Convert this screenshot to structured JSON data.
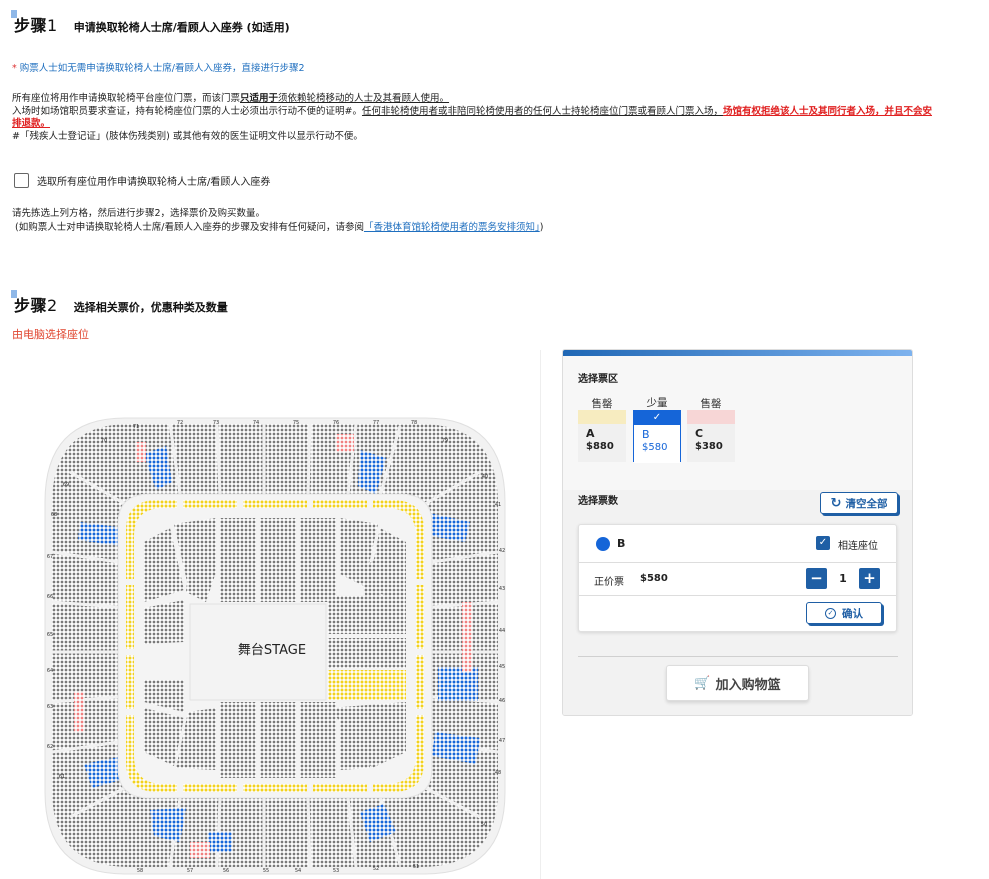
{
  "step1": {
    "label": "步骤",
    "number": "1",
    "title": "申请换取轮椅人士席/看顾人入座券 (如适用)",
    "skip_note_star": "*",
    "skip_note": " 购票人士如无需申请换取轮椅人士席/看顾人入座券，直接进行步骤2",
    "rules": {
      "line1_a": "所有座位将用作申请换取轮椅平台座位门票，而该门票",
      "line1_b": "只适用于",
      "line1_c": "须依赖轮椅移动的人士及其看顾人使用。",
      "line2_a": "入场时如场馆职员要求查证，持有轮椅座位门票的人士必须出示行动不便的证明#。",
      "line2_b": "任何非轮椅使用者或非陪同轮椅使用者的任何人士持轮椅座位门票或看顾人门票入场，",
      "line2_c": "场馆有权拒绝该人士及其同行者入场，并且不会安排退款。",
      "line3": "#「残疾人士登记证」(肢体伤残类别) 或其他有效的医生证明文件以显示行动不便。"
    },
    "checkbox_label": "选取所有座位用作申请换取轮椅人士席/看顾人入座券",
    "instr1": "请先拣选上列方格，然后进行步骤2，选择票价及购买数量。",
    "instr2_a": "(如购票人士对申请换取轮椅人士席/看顾人入座券的步骤及安排有任何疑问，请参阅",
    "instr2_link": "「香港体育馆轮椅使用者的票务安排须知」",
    "instr2_b": ")"
  },
  "step2": {
    "label": "步骤",
    "number": "2",
    "title": "选择相关票价，优惠种类及数量",
    "pc_select": "由电脑选择座位"
  },
  "map": {
    "stage_label": "舞台STAGE"
  },
  "panel": {
    "zone_heading": "选择票区",
    "zones": [
      {
        "status": "售罄",
        "zone": "A",
        "price": "$880",
        "color": "#f7ecc0"
      },
      {
        "status": "少量",
        "zone": "B",
        "price": "$580",
        "color": "#1565d8",
        "selected": true
      },
      {
        "status": "售罄",
        "zone": "C",
        "price": "$380",
        "color": "#f7d6d6"
      }
    ],
    "qty_heading": "选择票数",
    "clear_label": "清空全部",
    "selected_zone": "B",
    "adjacent_label": "相连座位",
    "ticket_type": "正价票",
    "ticket_price": "$580",
    "quantity": "1",
    "minus": "−",
    "plus": "+",
    "confirm_label": "确认",
    "cart_label": "加入购物篮"
  },
  "colors": {
    "accent": "#1f5fa5",
    "selected_blue": "#1565d8",
    "warning_red": "#e02020"
  }
}
